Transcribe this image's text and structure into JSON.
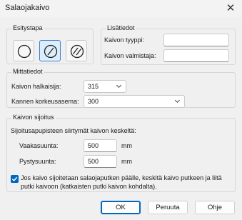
{
  "window": {
    "title": "Salaojakaivo",
    "close_glyph": "✕"
  },
  "esitystapa": {
    "legend": "Esitystapa",
    "buttons": [
      {
        "icon": "plain-circle-icon",
        "selected": false
      },
      {
        "icon": "circle-single-slash-icon",
        "selected": true
      },
      {
        "icon": "circle-double-slash-icon",
        "selected": false
      }
    ]
  },
  "lisatiedot": {
    "legend": "Lisätiedot",
    "tyyppi_label": "Kaivon tyyppi:",
    "tyyppi_value": "",
    "valmistaja_label": "Kaivon valmistaja:",
    "valmistaja_value": ""
  },
  "mittatiedot": {
    "legend": "Mittatiedot",
    "halkaisija_label": "Kaivon halkaisija:",
    "halkaisija_value": "315",
    "korkeus_label": "Kannen korkeusasema:",
    "korkeus_value": "300"
  },
  "sijoitus": {
    "legend": "Kaivon sijoitus",
    "intro": "Sijoitusapupisteen siirtymät kaivon keskeltä:",
    "vaaka_label": "Vaakasuunta:",
    "vaaka_value": "500",
    "vaaka_unit": "mm",
    "pysty_label": "Pystysuunta:",
    "pysty_value": "500",
    "pysty_unit": "mm",
    "checkbox_checked": true,
    "checkbox_text": "Jos kaivo sijoitetaan salaojaputken päälle, keskitä kaivo putkeen ja liitä putki kaivoon (katkaisten putki kaivon kohdalta)."
  },
  "buttons": {
    "ok": "OK",
    "cancel": "Peruuta",
    "help": "Ohje"
  },
  "colors": {
    "accent": "#0067c0",
    "selected_bg": "#ddeefb"
  }
}
